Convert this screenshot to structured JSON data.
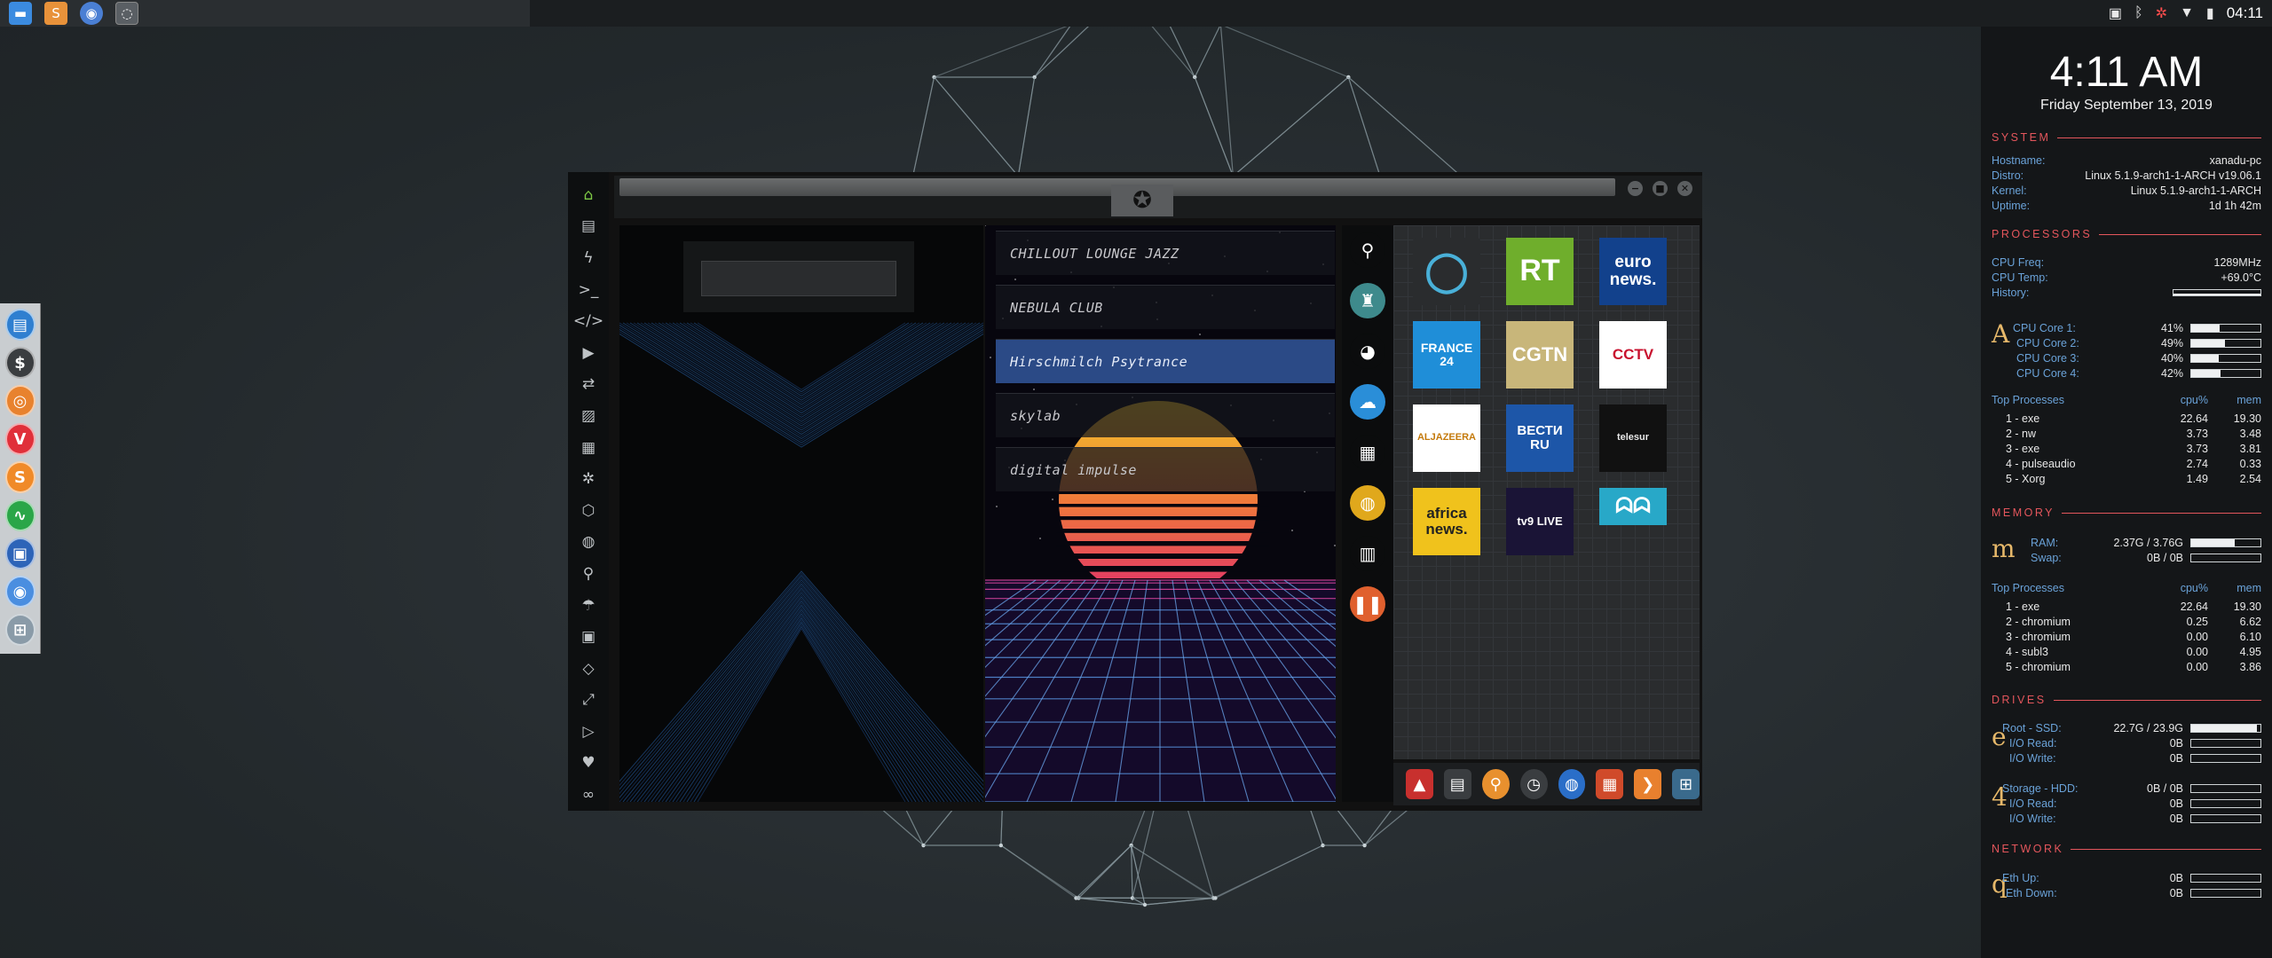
{
  "top_panel": {
    "launchers": [
      {
        "icon": "files-icon",
        "color": "#3b8be0"
      },
      {
        "icon": "sublime-icon",
        "color": "#e8923a"
      },
      {
        "icon": "chromium-icon",
        "color": "#4a7fd4"
      },
      {
        "icon": "app-icon",
        "color": "#5a5f64"
      }
    ],
    "tray_icons": [
      "image-icon",
      "bluetooth-icon",
      "settings-icon",
      "wifi-icon",
      "battery-icon"
    ],
    "clock": "04:11"
  },
  "dock": {
    "items": [
      {
        "icon": "files-icon",
        "glyph": "▤",
        "color": "#2f7fd0"
      },
      {
        "icon": "terminal-icon",
        "glyph": "$",
        "color": "#3a3d40"
      },
      {
        "icon": "ubuntu-icon",
        "glyph": "◎",
        "color": "#e8822e"
      },
      {
        "icon": "vivaldi-icon",
        "glyph": "V",
        "color": "#e0303a"
      },
      {
        "icon": "sublime-icon",
        "glyph": "S",
        "color": "#f08a28"
      },
      {
        "icon": "activity-icon",
        "glyph": "∿",
        "color": "#2aa648"
      },
      {
        "icon": "display-icon",
        "glyph": "▣",
        "color": "#2d64b8"
      },
      {
        "icon": "chromium-icon",
        "glyph": "◉",
        "color": "#4a8ee0"
      },
      {
        "icon": "apps-grid-icon",
        "glyph": "⊞",
        "color": "#8a9ba8"
      }
    ]
  },
  "window": {
    "sidebar_icons": [
      {
        "icon": "home-icon",
        "glyph": "⌂",
        "active": true
      },
      {
        "icon": "document-icon",
        "glyph": "▤"
      },
      {
        "icon": "flash-icon",
        "glyph": "ϟ"
      },
      {
        "icon": "terminal-icon",
        "glyph": ">_"
      },
      {
        "icon": "code-icon",
        "glyph": "</>"
      },
      {
        "icon": "play-icon",
        "glyph": "▶"
      },
      {
        "icon": "translate-icon",
        "glyph": "⇄"
      },
      {
        "icon": "image-icon",
        "glyph": "▨"
      },
      {
        "icon": "news-icon",
        "glyph": "▦"
      },
      {
        "icon": "aperture-icon",
        "glyph": "✲"
      },
      {
        "icon": "hexagon-icon",
        "glyph": "⬡"
      },
      {
        "icon": "globe-icon",
        "glyph": "◍"
      },
      {
        "icon": "search-icon",
        "glyph": "⚲"
      },
      {
        "icon": "umbrella-icon",
        "glyph": "☂"
      },
      {
        "icon": "contact-icon",
        "glyph": "▣"
      },
      {
        "icon": "code-brackets-icon",
        "glyph": "◇"
      },
      {
        "icon": "expand-icon",
        "glyph": "⤢"
      },
      {
        "icon": "youtube-icon",
        "glyph": "▷"
      },
      {
        "icon": "heart-icon",
        "glyph": "♥"
      },
      {
        "icon": "infinity-icon",
        "glyph": "∞"
      }
    ],
    "controls": {
      "minimize": "−",
      "maximize": "■",
      "close": "✕"
    },
    "emblem": "rebel-alliance-icon",
    "search_placeholder": "",
    "stations": [
      {
        "name": "CHILLOUT LOUNGE JAZZ",
        "active": false
      },
      {
        "name": "NEBULA CLUB",
        "active": false
      },
      {
        "name": "Hirschmilch Psytrance",
        "active": true
      },
      {
        "name": "skylab",
        "active": false
      },
      {
        "name": "digital impulse",
        "active": false
      }
    ],
    "tv_rail": [
      {
        "icon": "search-icon",
        "glyph": "⚲",
        "color": "#0b0c0d"
      },
      {
        "icon": "radio-tower-icon",
        "glyph": "♜",
        "color": "#3e8a8c"
      },
      {
        "icon": "pikachu-icon",
        "glyph": "◕",
        "color": "#0b0c0d"
      },
      {
        "icon": "cloud-icon",
        "glyph": "☁",
        "color": "#2a8ed8"
      },
      {
        "icon": "clapper-icon",
        "glyph": "▦",
        "color": "#0b0c0d"
      },
      {
        "icon": "satellite-icon",
        "glyph": "◍",
        "color": "#e0a81c"
      },
      {
        "icon": "file-icon",
        "glyph": "▥",
        "color": "#0b0c0d"
      },
      {
        "icon": "pause-icon",
        "glyph": "❚❚",
        "color": "#e0602e"
      }
    ],
    "channels": [
      {
        "name": "channel-eye",
        "label": "◯",
        "bg": "#2a2c2e",
        "fg": "#49b0d8",
        "size": 44
      },
      {
        "name": "channel-rt",
        "label": "RT",
        "bg": "#6fae2c",
        "fg": "#ffffff",
        "size": 34
      },
      {
        "name": "channel-euronews",
        "label": "euro\nnews.",
        "bg": "#12418c",
        "fg": "#ffffff",
        "size": 19
      },
      {
        "name": "channel-france24",
        "label": "FRANCE\n24",
        "bg": "#1f8ed8",
        "fg": "#ffffff",
        "size": 14
      },
      {
        "name": "channel-cgtn",
        "label": "CGTN",
        "bg": "#c8b67a",
        "fg": "#ffffff",
        "size": 22
      },
      {
        "name": "channel-cctv",
        "label": "CCTV",
        "bg": "#ffffff",
        "fg": "#c8102e",
        "size": 17
      },
      {
        "name": "channel-aljazeera",
        "label": "ALJAZEERA",
        "bg": "#ffffff",
        "fg": "#c47a0c",
        "size": 11
      },
      {
        "name": "channel-vesti",
        "label": "ВЕСТИ\nRU",
        "bg": "#1d56a8",
        "fg": "#ffffff",
        "size": 15
      },
      {
        "name": "channel-telesur",
        "label": "telesur",
        "bg": "#111111",
        "fg": "#e8e8e8",
        "size": 11
      },
      {
        "name": "channel-africanews",
        "label": "africa\nnews.",
        "bg": "#f0c21c",
        "fg": "#222222",
        "size": 17
      },
      {
        "name": "channel-tv9",
        "label": "tv9 LIVE",
        "bg": "#1a1436",
        "fg": "#ffffff",
        "size": 13
      },
      {
        "name": "channel-abc",
        "label": "ᗣᗣ",
        "bg": "#28a8c8",
        "fg": "#ffffff",
        "size": 24
      }
    ],
    "bottom_bar": [
      {
        "icon": "arch-icon",
        "glyph": "▲",
        "color": "#c8302e"
      },
      {
        "icon": "calendar-note-icon",
        "glyph": "▤",
        "color": "#3a3d40"
      },
      {
        "icon": "search-app-icon",
        "glyph": "⚲",
        "color": "#e8902e"
      },
      {
        "icon": "clock-icon",
        "glyph": "◷",
        "color": "#3a3d40"
      },
      {
        "icon": "globe-app-icon",
        "glyph": "◍",
        "color": "#2a6ec8"
      },
      {
        "icon": "calendar-icon",
        "glyph": "▦",
        "color": "#d04a2a"
      },
      {
        "icon": "arrow-icon",
        "glyph": "❯",
        "color": "#e8802e"
      },
      {
        "icon": "grid-app-icon",
        "glyph": "⊞",
        "color": "#3a6a8c"
      }
    ]
  },
  "conky": {
    "time": "4:11 AM",
    "date": "Friday September 13, 2019",
    "system": {
      "title": "SYSTEM",
      "rows": [
        {
          "label": "Hostname:",
          "value": "xanadu-pc"
        },
        {
          "label": "Distro:",
          "value": "Linux 5.1.9-arch1-1-ARCH v19.06.1"
        },
        {
          "label": "Kernel:",
          "value": "Linux 5.1.9-arch1-1-ARCH"
        },
        {
          "label": "Uptime:",
          "value": "1d 1h 42m"
        }
      ]
    },
    "processors": {
      "title": "PROCESSORS",
      "freq_label": "CPU Freq:",
      "freq": "1289MHz",
      "temp_label": "CPU Temp:",
      "temp": "+69.0°C",
      "history_label": "History:",
      "letter": "A",
      "cores": [
        {
          "label": "CPU Core 1:",
          "value": "41%",
          "level": 0.41
        },
        {
          "label": "CPU Core 2:",
          "value": "49%",
          "level": 0.49
        },
        {
          "label": "CPU Core 3:",
          "value": "40%",
          "level": 0.4
        },
        {
          "label": "CPU Core 4:",
          "value": "42%",
          "level": 0.42
        }
      ],
      "top_title": "Top Processes",
      "cpu_head": "cpu%",
      "mem_head": "mem",
      "top": [
        {
          "name": "1 - exe",
          "cpu": "22.64",
          "mem": "19.30"
        },
        {
          "name": "2 - nw",
          "cpu": "3.73",
          "mem": "3.48"
        },
        {
          "name": "3 - exe",
          "cpu": "3.73",
          "mem": "3.81"
        },
        {
          "name": "4 - pulseaudio",
          "cpu": "2.74",
          "mem": "0.33"
        },
        {
          "name": "5 - Xorg",
          "cpu": "1.49",
          "mem": "2.54"
        }
      ]
    },
    "memory": {
      "title": "MEMORY",
      "letter": "m",
      "ram_label": "RAM:",
      "ram": "2.37G / 3.76G",
      "ram_level": 0.63,
      "swap_label": "Swap:",
      "swap": "0B / 0B",
      "swap_level": 0,
      "top_title": "Top Processes",
      "cpu_head": "cpu%",
      "mem_head": "mem",
      "top": [
        {
          "name": "1 - exe",
          "cpu": "22.64",
          "mem": "19.30"
        },
        {
          "name": "2 - chromium",
          "cpu": "0.25",
          "mem": "6.62"
        },
        {
          "name": "3 - chromium",
          "cpu": "0.00",
          "mem": "6.10"
        },
        {
          "name": "4 - subl3",
          "cpu": "0.00",
          "mem": "4.95"
        },
        {
          "name": "5 - chromium",
          "cpu": "0.00",
          "mem": "3.86"
        }
      ]
    },
    "drives": {
      "title": "DRIVES",
      "root_letter": "e",
      "root_label": "Root  -  SSD:",
      "root": "22.7G / 23.9G",
      "root_level": 0.95,
      "root_read_label": "I/O Read:",
      "root_read": "0B",
      "root_write_label": "I/O Write:",
      "root_write": "0B",
      "storage_letter": "4",
      "storage_label": "Storage  -  HDD:",
      "storage": "0B / 0B",
      "storage_level": 0,
      "storage_read_label": "I/O Read:",
      "storage_read": "0B",
      "storage_write_label": "I/O Write:",
      "storage_write": "0B"
    },
    "network": {
      "title": "NETWORK",
      "letter": "q",
      "up_label": "Eth Up:",
      "up": "0B",
      "down_label": "Eth Down:",
      "down": "0B"
    }
  }
}
